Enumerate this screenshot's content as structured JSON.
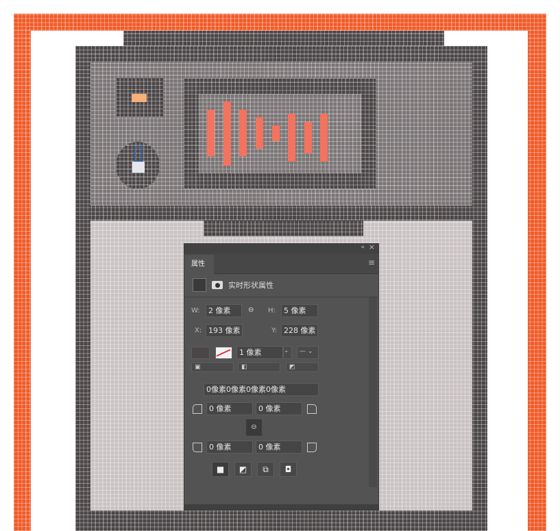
{
  "colors": {
    "border": "#f05a28",
    "dark": "#4a4546",
    "mid": "#7a7475",
    "light": "#c9c2c2",
    "bars": "#f4735f",
    "indicator": "#f7b07a"
  },
  "panel": {
    "tab": "属性",
    "section_title": "实时形状属性",
    "w_label": "W:",
    "w_value": "2 像素",
    "h_label": "H:",
    "h_value": "5 像素",
    "x_label": "X:",
    "x_value": "193 像素",
    "y_label": "Y:",
    "y_value": "228 像素",
    "stroke_width": "1 像素",
    "corner_radii": "0像素0像素0像素0像素",
    "corner_tl": "0 像素",
    "corner_tr": "0 像素",
    "corner_bl": "0 像素",
    "corner_br": "0 像素",
    "collapse_icon": "«",
    "close_icon": "×",
    "menu_icon": "≡",
    "link_icon": "⊖"
  }
}
